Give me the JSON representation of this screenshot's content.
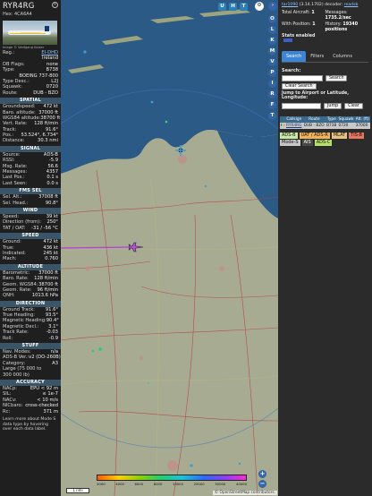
{
  "aircraft": {
    "callsign": "RYR4RG",
    "hex": "Hex:  4CA6A4",
    "photo_credit": "Image © Wolfgang Kaiser",
    "basic_rows": [
      {
        "k": "Reg.:",
        "v": "EI-DHD",
        "link": true
      },
      {
        "k": "",
        "v": "Ireland"
      },
      {
        "k": "DB Flags:",
        "v": "none"
      },
      {
        "k": "Type:",
        "v": "B738"
      },
      {
        "k": "",
        "v": "BOEING 737-800"
      },
      {
        "k": "Type Desc.:",
        "v": "L2J"
      },
      {
        "k": "Squawk:",
        "v": "0720"
      },
      {
        "k": "Route:",
        "v": "DUB - BZO"
      }
    ],
    "sections": [
      {
        "title": "SPATIAL",
        "rows": [
          {
            "k": "Groundspeed:",
            "v": "472 kt"
          },
          {
            "k": "Baro. altitude:",
            "v": "37000 ft"
          },
          {
            "k": "WGS84 altitude:",
            "v": "38700 ft"
          },
          {
            "k": "Vert. Rate:",
            "v": "128 ft/min"
          },
          {
            "k": "Track:",
            "v": "91.6°"
          },
          {
            "k": "Pos.:",
            "v": "53.524°, 6.734°"
          },
          {
            "k": "Distance:",
            "v": "30.3 nmi"
          }
        ]
      },
      {
        "title": "SIGNAL",
        "rows": [
          {
            "k": "Source:",
            "v": "ADS-B"
          },
          {
            "k": "RSSI:",
            "v": "-5.9"
          },
          {
            "k": "Msg. Rate:",
            "v": "56.6"
          },
          {
            "k": "Messages:",
            "v": "4357"
          },
          {
            "k": "Last Pos.:",
            "v": "0.1 s"
          },
          {
            "k": "Last Seen:",
            "v": "0.0 s"
          }
        ]
      },
      {
        "title": "FMS SEL",
        "rows": [
          {
            "k": "Sel. Alt.:",
            "v": "37008 ft"
          },
          {
            "k": "Sel. Head.:",
            "v": "90.8°"
          }
        ]
      },
      {
        "title": "WIND",
        "rows": [
          {
            "k": "Speed:",
            "v": "39 kt"
          },
          {
            "k": "Direction (from):",
            "v": "250°"
          },
          {
            "k": "TAT / OAT:",
            "v": "-31 / -56 °C"
          }
        ]
      },
      {
        "title": "SPEED",
        "rows": [
          {
            "k": "Ground:",
            "v": "472 kt"
          },
          {
            "k": "True:",
            "v": "436 kt"
          },
          {
            "k": "Indicated:",
            "v": "245 kt"
          },
          {
            "k": "Mach:",
            "v": "0.760"
          }
        ]
      },
      {
        "title": "ALTITUDE",
        "rows": [
          {
            "k": "Barometric:",
            "v": "37000 ft"
          },
          {
            "k": "Baro. Rate:",
            "v": "128 ft/min"
          },
          {
            "k": "Geom. WGS84:",
            "v": "38700 ft"
          },
          {
            "k": "Geom. Rate:",
            "v": "96 ft/min"
          },
          {
            "k": "QNH:",
            "v": "1013.6 hPa"
          }
        ]
      },
      {
        "title": "DIRECTION",
        "rows": [
          {
            "k": "Ground Track:",
            "v": "91.6°"
          },
          {
            "k": "True Heading:",
            "v": "93.5°"
          },
          {
            "k": "Magnetic Heading:",
            "v": "90.4°"
          },
          {
            "k": "Magnetic Decl.:",
            "v": "3.1°"
          },
          {
            "k": "Track Rate:",
            "v": "-0.03"
          },
          {
            "k": "Roll:",
            "v": "-0.9"
          }
        ]
      },
      {
        "title": "STUFF",
        "rows": [
          {
            "k": "Nav. Modes:",
            "v": "n/a"
          },
          {
            "k": "ADS-B Ver.:",
            "v": "v2 (DO-260B)"
          },
          {
            "k": "Category:",
            "v": "A3"
          },
          {
            "k": "Large (75 000 to",
            "v": ""
          },
          {
            "k": "300 000 lb)",
            "v": ""
          }
        ]
      },
      {
        "title": "ACCURACY",
        "rows": [
          {
            "k": "NACp:",
            "v": "EPU < 92 m"
          },
          {
            "k": "SIL:",
            "v": "≤ 1e-7"
          },
          {
            "k": "NACv:",
            "v": "< 10 m/s"
          },
          {
            "k": "NICbaro:",
            "v": "cross-checked"
          },
          {
            "k": "Rc:",
            "v": "371 m"
          }
        ]
      }
    ],
    "note": "Learn more about Mode S data type by hovering over each data label."
  },
  "map": {
    "top_buttons": [
      "U",
      "H",
      "T"
    ],
    "side_buttons": [
      "O",
      "L",
      "K",
      "M",
      "V",
      "P",
      "I",
      "R",
      "F",
      "T"
    ],
    "scale_label": "1 nmi",
    "attribution": "© OpenStreetMap contributors.",
    "altitude_labels": [
      "2000",
      "4000",
      "6000",
      "8000",
      "10000",
      "20000",
      "30000",
      "40000"
    ],
    "zoom_in": "+",
    "zoom_out": "−"
  },
  "sidebar": {
    "version_prefix": "",
    "version_link": "tar1090",
    "version_suffix": " (3.14.1702) decoder:",
    "version_readsb": "readsb",
    "total_aircraft_label": "Total Aircraft:",
    "total_aircraft": "1",
    "messages_label": "Messages:",
    "messages": "1735.2/sec",
    "with_position_label": "With Position:",
    "with_position": "1",
    "history_label": "History:",
    "history": "19340 positions",
    "stats_link": "Stats enabled",
    "tabs": [
      "Search",
      "Filters",
      "Columns"
    ],
    "search_label": "Search:",
    "search_button": "Search",
    "clear_search_button": "Clear Search",
    "jump_label": "Jump to Airport or Latitude, Longitude:",
    "jump_button": "Jump",
    "clear_button": "Clear",
    "table_headers": [
      "Callsign",
      "Route",
      "Type",
      "Squawk",
      "Alt. (ft)"
    ],
    "table_row": {
      "callsign": "RYR4RG",
      "route": "DUB - BZO",
      "type": "B738",
      "squawk": "0720",
      "alt": "37000"
    },
    "legend": [
      {
        "label": "ADS-B",
        "color": "#c7e8a7"
      },
      {
        "label": "UAT / ADS-R",
        "color": "#f0b35b"
      },
      {
        "label": "MLAT",
        "color": "#e8c27f"
      },
      {
        "label": "TIS-B",
        "color": "#e87560"
      },
      {
        "label": "Mode-S",
        "color": "#c7c7c7"
      },
      {
        "label": "AIS",
        "color": "#4a4a4a"
      },
      {
        "label": "ADS-C",
        "color": "#b6e06a"
      }
    ]
  },
  "colors": {
    "panel_header": "#3a5567",
    "accent": "#3b84d6",
    "track": "#b040e0"
  }
}
